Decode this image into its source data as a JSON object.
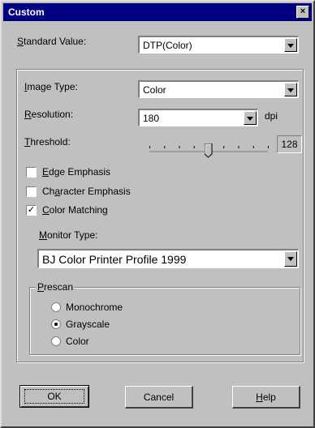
{
  "window": {
    "title": "Custom",
    "close_symbol": "×"
  },
  "standard_value": {
    "label_prefix": "S",
    "label_rest": "tandard Value:",
    "selected": "DTP(Color)"
  },
  "image_type": {
    "label_prefix": "I",
    "label_rest": "mage Type:",
    "selected": "Color"
  },
  "resolution": {
    "label_prefix": "R",
    "label_rest": "esolution:",
    "selected": "180",
    "unit": "dpi"
  },
  "threshold": {
    "label_prefix": "T",
    "label_rest": "hreshold:",
    "value": "128",
    "level": 128,
    "min": 0,
    "max": 255
  },
  "checkboxes": [
    {
      "prefix": "E",
      "rest": "dge Emphasis",
      "checked": false
    },
    {
      "prefix": "Ch",
      "underline": "a",
      "rest": "racter Emphasis",
      "checked": false
    },
    {
      "prefix": "C",
      "rest": "olor Matching",
      "checked": true
    }
  ],
  "monitor_type": {
    "label_prefix": "M",
    "label_rest": "onitor Type:",
    "selected": "BJ Color Printer Profile 1999"
  },
  "prescan": {
    "label_prefix": "P",
    "label_rest": "rescan",
    "options": [
      {
        "label": "Monochrome",
        "checked": false
      },
      {
        "label": "Grayscale",
        "checked": true
      },
      {
        "label": "Color",
        "checked": false
      }
    ]
  },
  "buttons": {
    "ok": "OK",
    "cancel": "Cancel",
    "help_prefix": "H",
    "help_rest": "elp"
  },
  "check_mark": "✓",
  "colors": {
    "titlebar": "#000080",
    "face": "#c0c0c0"
  }
}
